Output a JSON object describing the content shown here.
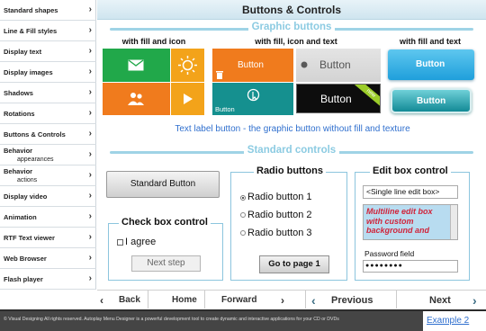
{
  "sidebar": {
    "items": [
      {
        "label": "Standard shapes"
      },
      {
        "label": "Line & Fill styles"
      },
      {
        "label": "Display text"
      },
      {
        "label": "Display images"
      },
      {
        "label": "Shadows"
      },
      {
        "label": "Rotations"
      },
      {
        "label": "Buttons & Controls"
      },
      {
        "label": "Behavior",
        "sub": "appearances"
      },
      {
        "label": "Behavior",
        "sub": "actions"
      },
      {
        "label": "Display video"
      },
      {
        "label": "Animation"
      },
      {
        "label": "RTF Text viewer"
      },
      {
        "label": "Web Browser"
      },
      {
        "label": "Flash player"
      }
    ],
    "arrow": "›"
  },
  "header": {
    "title": "Buttons & Controls"
  },
  "graphic": {
    "section_title": "Graphic buttons",
    "col1": "with fill and icon",
    "col2": "with fill, icon and text",
    "col3": "with fill and text",
    "btn_orange": "Button",
    "btn_gray": "Button",
    "btn_blue": "Button",
    "btn_teal": "Button",
    "btn_black": "Button",
    "btn_teal2": "Button",
    "new_badge": "new",
    "text_label_button": "Text label button - the graphic button without fill and texture"
  },
  "standard": {
    "section_title": "Standard controls",
    "standard_button": "Standard Button"
  },
  "checkbox": {
    "legend": "Check box control",
    "label": "I agree",
    "next_step": "Next step"
  },
  "radio": {
    "legend": "Radio buttons",
    "options": [
      "Radio button 1",
      "Radio button 2",
      "Radio button 3"
    ],
    "goto": "Go to page 1"
  },
  "edit": {
    "legend": "Edit box control",
    "single": "<Single line edit box>",
    "multi": "Multiline edit box with custom background and",
    "password_label": "Password field",
    "password_value": "●●●●●●●●"
  },
  "nav": {
    "back": "Back",
    "home": "Home",
    "forward": "Forward",
    "previous": "Previous",
    "next": "Next",
    "left": "‹",
    "right": "›"
  },
  "footer": {
    "text": "© Visual Designing All rights reserved. Autoplay Menu Designer is a powerful development tool to create dynamic and interactive applications for your CD or DVDs",
    "example": "Example 2"
  },
  "colors": {
    "green": "#20a84a",
    "orange_tile": "#f07b1d",
    "amber": "#f3a31a",
    "blue_text": "#2f6fce",
    "accent_line": "#9fd3e6"
  },
  "icons": [
    "mail-icon",
    "sun-icon",
    "people-icon",
    "play-icon",
    "trash-icon",
    "cursor-icon",
    "dot-icon"
  ]
}
